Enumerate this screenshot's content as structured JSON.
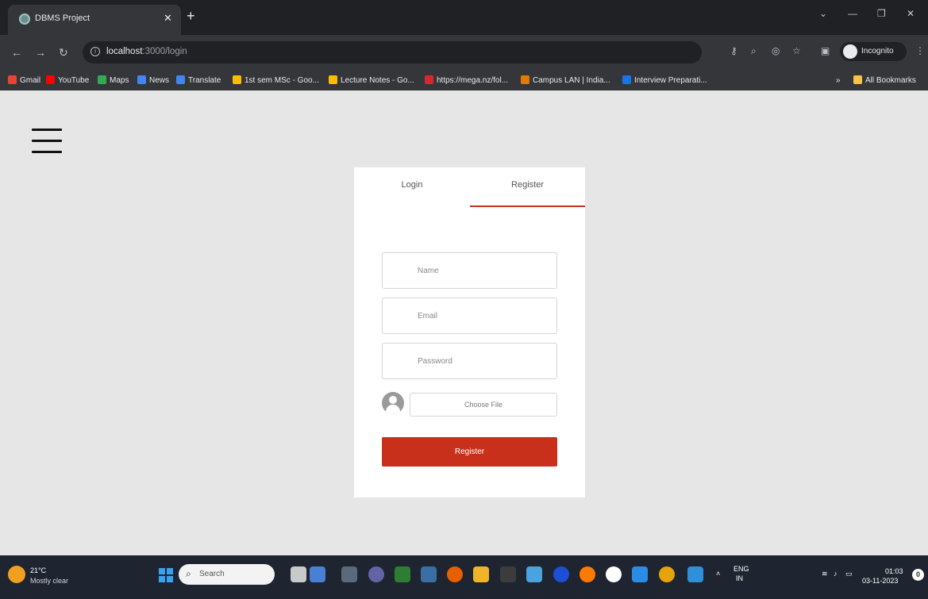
{
  "browser": {
    "tab_title": "DBMS Project",
    "new_tab_symbol": "+",
    "url_host": "localhost",
    "url_path": ":3000/login",
    "profile_label": "Incognito",
    "bookmarks": [
      {
        "label": "Gmail",
        "color": "#ea4335"
      },
      {
        "label": "YouTube",
        "color": "#ff0000"
      },
      {
        "label": "Maps",
        "color": "#34a853"
      },
      {
        "label": "News",
        "color": "#4285f4"
      },
      {
        "label": "Translate",
        "color": "#4285f4"
      },
      {
        "label": "1st sem MSc - Goo...",
        "color": "#fbbc04"
      },
      {
        "label": "Lecture Notes - Go...",
        "color": "#fbbc04"
      },
      {
        "label": "https://mega.nz/fol...",
        "color": "#d9272e"
      },
      {
        "label": "Campus LAN | India...",
        "color": "#e07b00"
      },
      {
        "label": "Interview Preparati...",
        "color": "#1a73e8"
      },
      {
        "label": "All Bookmarks",
        "color": "#f6c344"
      }
    ]
  },
  "auth_card": {
    "login_tab": "Login",
    "register_tab": "Register",
    "name_placeholder": "Name",
    "email_placeholder": "Email",
    "password_placeholder": "Password",
    "file_button": "Choose File",
    "submit_label": "Register",
    "accent_color": "#c9301b"
  },
  "taskbar": {
    "temperature": "21°C",
    "weather": "Mostly clear",
    "search_label": "Search",
    "language": "ENG",
    "region": "IN",
    "time": "01:03",
    "date": "03-11-2023",
    "notification_count": "0"
  }
}
